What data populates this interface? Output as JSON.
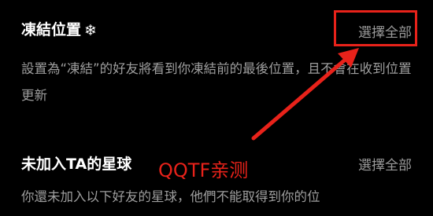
{
  "freeze_section": {
    "title": "凍結位置",
    "icon": "snowflake-icon",
    "icon_glyph": "❄",
    "select_all": "選擇全部",
    "description": "設置為“凍結”的好友將看到你凍結前的最後位置，且不會在收到位置更新"
  },
  "planet_section": {
    "title": "未加入TA的星球",
    "select_all": "選擇全部",
    "description": "你還未加入以下好友的星球，他們不能取得到你的位"
  },
  "annotation": {
    "watermark": "QQTF亲测",
    "color": "#e8221a"
  }
}
